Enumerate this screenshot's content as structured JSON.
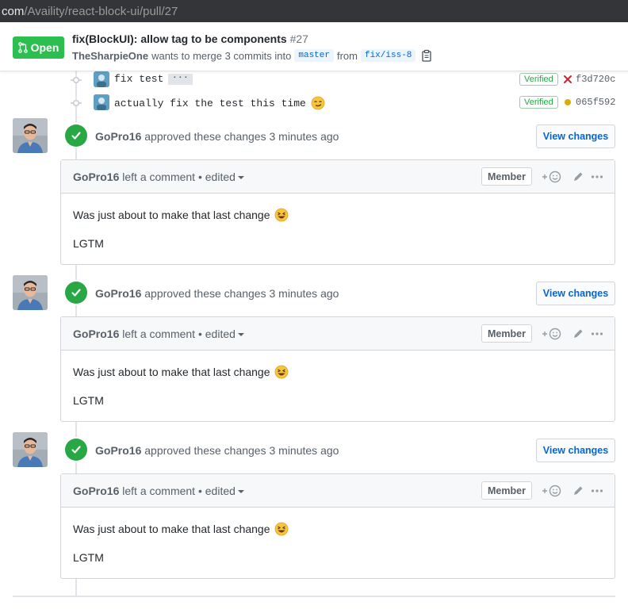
{
  "url": {
    "host": "com",
    "path": "/Availity/react-block-ui/pull/27"
  },
  "pr": {
    "state": "Open",
    "title": "fix(BlockUI): allow tag to be components",
    "number": "#27",
    "author": "TheSharpieOne",
    "merge_text": "wants to merge 3 commits into",
    "base_branch": "master",
    "from_text": "from",
    "head_branch": "fix/iss-8"
  },
  "commits": [
    {
      "message": "fix test",
      "has_ellipsis": true,
      "ellipsis": "···",
      "verified": "Verified",
      "status": "failure",
      "sha": "f3d720c"
    },
    {
      "message": "actually fix the test this time",
      "has_ellipsis": false,
      "verified": "Verified",
      "status": "pending",
      "sha": "065f592"
    }
  ],
  "reviews": [
    {
      "user": "GoPro16",
      "action_text": "approved these changes",
      "time": "3 minutes ago",
      "view_label": "View changes",
      "comment_user": "GoPro16",
      "comment_action": "left a comment",
      "edited": "• edited",
      "role": "Member",
      "body_line1": "Was just about to make that last change",
      "body_line2": "LGTM"
    },
    {
      "user": "GoPro16",
      "action_text": "approved these changes",
      "time": "3 minutes ago",
      "view_label": "View changes",
      "comment_user": "GoPro16",
      "comment_action": "left a comment",
      "edited": "• edited",
      "role": "Member",
      "body_line1": "Was just about to make that last change",
      "body_line2": "LGTM"
    },
    {
      "user": "GoPro16",
      "action_text": "approved these changes",
      "time": "3 minutes ago",
      "view_label": "View changes",
      "comment_user": "GoPro16",
      "comment_action": "left a comment",
      "edited": "• edited",
      "role": "Member",
      "body_line1": "Was just about to make that last change",
      "body_line2": "LGTM"
    }
  ],
  "colors": {
    "open_green": "#2cbe4e",
    "approve_green": "#28a745",
    "link_blue": "#0366d6",
    "failure_red": "#cb2431",
    "pending_yellow": "#dbab09"
  }
}
